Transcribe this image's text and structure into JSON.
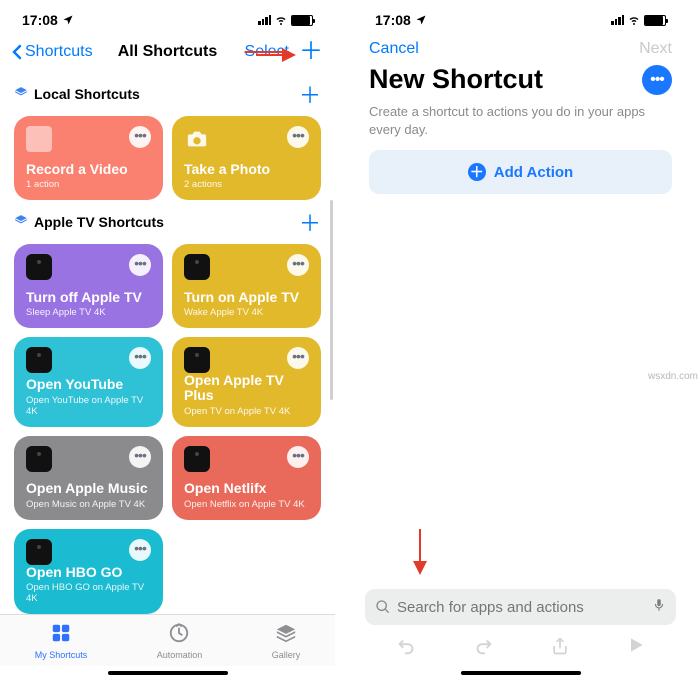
{
  "statusbar": {
    "time": "17:08"
  },
  "left": {
    "back_label": "Shortcuts",
    "title": "All Shortcuts",
    "right_hidden_label": "Select",
    "sections": {
      "local": {
        "title": "Local Shortcuts"
      },
      "atv": {
        "title": "Apple TV Shortcuts"
      }
    },
    "cards": {
      "record": {
        "title": "Record a Video",
        "sub": "1 action"
      },
      "photo": {
        "title": "Take a Photo",
        "sub": "2 actions"
      },
      "tvoff": {
        "title": "Turn off Apple TV",
        "sub": "Sleep Apple TV 4K"
      },
      "tvon": {
        "title": "Turn on Apple TV",
        "sub": "Wake Apple TV 4K"
      },
      "yt": {
        "title": "Open YouTube",
        "sub": "Open YouTube on Apple TV 4K"
      },
      "atvp": {
        "title": "Open Apple TV Plus",
        "sub": "Open TV on Apple TV 4K"
      },
      "music": {
        "title": "Open Apple Music",
        "sub": "Open Music on Apple TV 4K"
      },
      "netf": {
        "title": "Open Netlifx",
        "sub": "Open Netflix on Apple TV 4K"
      },
      "hbo": {
        "title": "Open HBO GO",
        "sub": "Open HBO GO on Apple TV 4K"
      }
    },
    "tabs": {
      "myshortcuts": "My Shortcuts",
      "automation": "Automation",
      "gallery": "Gallery"
    }
  },
  "right": {
    "cancel": "Cancel",
    "next": "Next",
    "title": "New Shortcut",
    "subtitle": "Create a shortcut to actions you do in your apps every day.",
    "add_action": "Add Action",
    "search_placeholder": "Search for apps and actions"
  },
  "watermark": "wsxdn.com"
}
